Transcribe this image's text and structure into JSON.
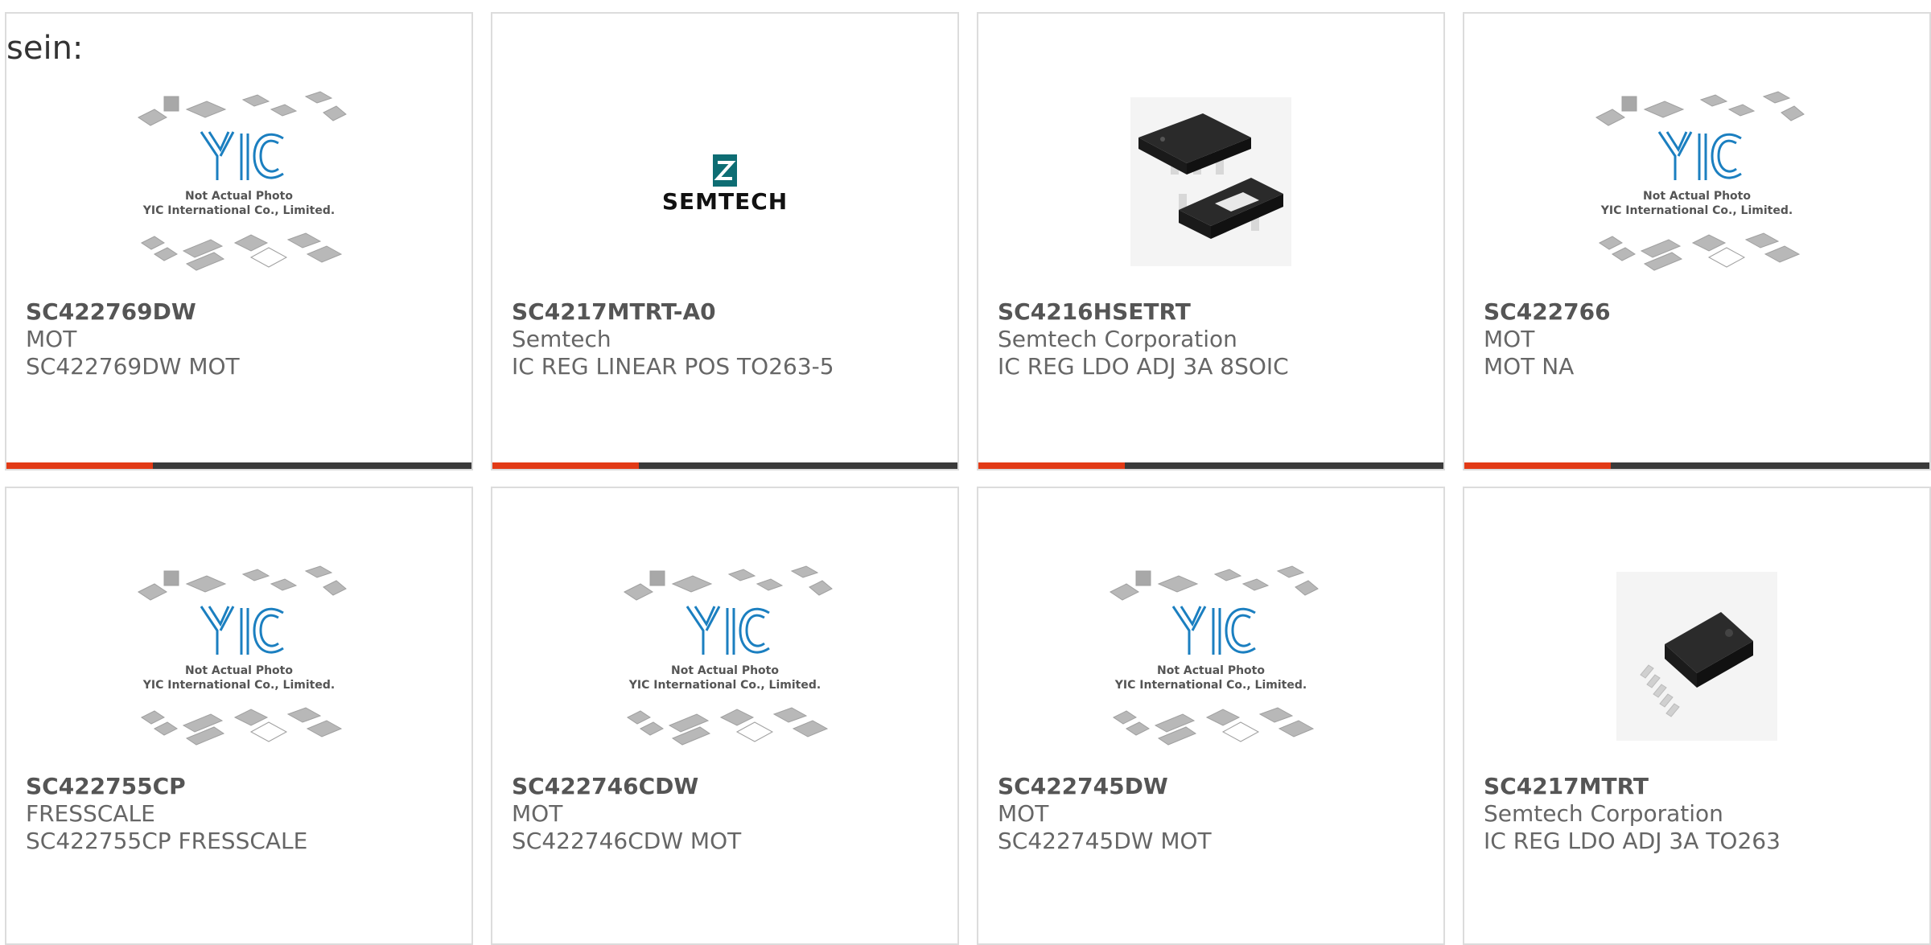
{
  "lead_text": "sein:",
  "placeholder": {
    "line1": "Not Actual Photo",
    "line2": "YIC International Co., Limited."
  },
  "semtech_logo_text": "SEMTECH",
  "colors": {
    "accent": "#e23a16",
    "bar": "#3a3a3a",
    "logo_blue": "#1b7fc0",
    "semtech_teal": "#0e6d73"
  },
  "products": [
    {
      "part": "SC422769DW",
      "maker": "MOT",
      "desc": "SC422769DW MOT",
      "image": "placeholder"
    },
    {
      "part": "SC4217MTRT-A0",
      "maker": "Semtech",
      "desc": "IC REG LINEAR POS TO263-5",
      "image": "semtech-logo"
    },
    {
      "part": "SC4216HSETRT",
      "maker": "Semtech Corporation",
      "desc": "IC REG LDO ADJ 3A 8SOIC",
      "image": "chip-soic"
    },
    {
      "part": "SC422766",
      "maker": "MOT",
      "desc": "MOT NA",
      "image": "placeholder"
    },
    {
      "part": "SC422755CP",
      "maker": "FRESSCALE",
      "desc": "SC422755CP FRESSCALE",
      "image": "placeholder"
    },
    {
      "part": "SC422746CDW",
      "maker": "MOT",
      "desc": "SC422746CDW MOT",
      "image": "placeholder"
    },
    {
      "part": "SC422745DW",
      "maker": "MOT",
      "desc": "SC422745DW MOT",
      "image": "placeholder"
    },
    {
      "part": "SC4217MTRT",
      "maker": "Semtech Corporation",
      "desc": "IC REG LDO ADJ 3A TO263",
      "image": "chip-to263"
    }
  ]
}
